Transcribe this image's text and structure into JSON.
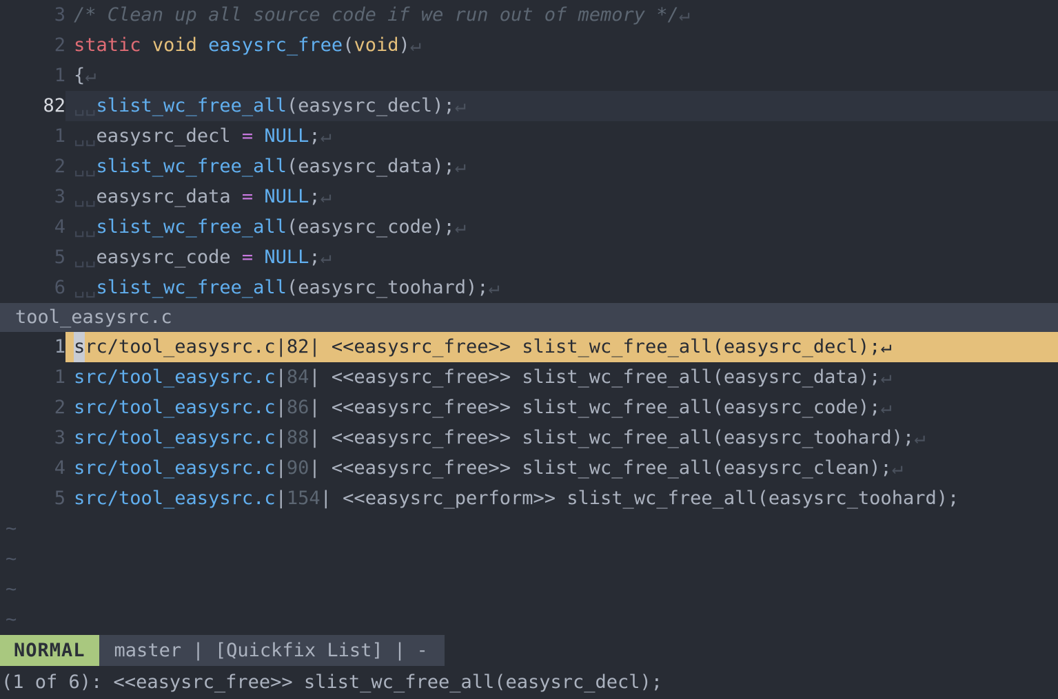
{
  "editor": {
    "window_name": "source-code-window",
    "lines": [
      {
        "num": "3",
        "current": false,
        "segments": [
          {
            "cls": "cmt",
            "text": "/* Clean up all source code if we run out of memory */"
          },
          {
            "cls": "eol",
            "text": "↵"
          }
        ]
      },
      {
        "num": "2",
        "current": false,
        "segments": [
          {
            "cls": "kw",
            "text": "static"
          },
          {
            "cls": "id",
            "text": " "
          },
          {
            "cls": "type",
            "text": "void"
          },
          {
            "cls": "id",
            "text": " "
          },
          {
            "cls": "fn",
            "text": "easysrc_free"
          },
          {
            "cls": "punc",
            "text": "("
          },
          {
            "cls": "type",
            "text": "void"
          },
          {
            "cls": "punc",
            "text": ")"
          },
          {
            "cls": "eol",
            "text": "↵"
          }
        ]
      },
      {
        "num": "1",
        "current": false,
        "segments": [
          {
            "cls": "punc",
            "text": "{"
          },
          {
            "cls": "eol",
            "text": "↵"
          }
        ]
      },
      {
        "num": "82",
        "current": true,
        "segments": [
          {
            "cls": "spc",
            "text": "␣␣"
          },
          {
            "cls": "fn",
            "text": "slist_wc_free_all"
          },
          {
            "cls": "punc",
            "text": "("
          },
          {
            "cls": "id",
            "text": "easysrc_decl"
          },
          {
            "cls": "punc",
            "text": ");"
          },
          {
            "cls": "eol",
            "text": "↵"
          }
        ]
      },
      {
        "num": "1",
        "current": false,
        "segments": [
          {
            "cls": "spc",
            "text": "␣␣"
          },
          {
            "cls": "id",
            "text": "easysrc_decl "
          },
          {
            "cls": "op",
            "text": "="
          },
          {
            "cls": "id",
            "text": " "
          },
          {
            "cls": "const",
            "text": "NULL"
          },
          {
            "cls": "punc",
            "text": ";"
          },
          {
            "cls": "eol",
            "text": "↵"
          }
        ]
      },
      {
        "num": "2",
        "current": false,
        "segments": [
          {
            "cls": "spc",
            "text": "␣␣"
          },
          {
            "cls": "fn",
            "text": "slist_wc_free_all"
          },
          {
            "cls": "punc",
            "text": "("
          },
          {
            "cls": "id",
            "text": "easysrc_data"
          },
          {
            "cls": "punc",
            "text": ");"
          },
          {
            "cls": "eol",
            "text": "↵"
          }
        ]
      },
      {
        "num": "3",
        "current": false,
        "segments": [
          {
            "cls": "spc",
            "text": "␣␣"
          },
          {
            "cls": "id",
            "text": "easysrc_data "
          },
          {
            "cls": "op",
            "text": "="
          },
          {
            "cls": "id",
            "text": " "
          },
          {
            "cls": "const",
            "text": "NULL"
          },
          {
            "cls": "punc",
            "text": ";"
          },
          {
            "cls": "eol",
            "text": "↵"
          }
        ]
      },
      {
        "num": "4",
        "current": false,
        "segments": [
          {
            "cls": "spc",
            "text": "␣␣"
          },
          {
            "cls": "fn",
            "text": "slist_wc_free_all"
          },
          {
            "cls": "punc",
            "text": "("
          },
          {
            "cls": "id",
            "text": "easysrc_code"
          },
          {
            "cls": "punc",
            "text": ");"
          },
          {
            "cls": "eol",
            "text": "↵"
          }
        ]
      },
      {
        "num": "5",
        "current": false,
        "segments": [
          {
            "cls": "spc",
            "text": "␣␣"
          },
          {
            "cls": "id",
            "text": "easysrc_code "
          },
          {
            "cls": "op",
            "text": "="
          },
          {
            "cls": "id",
            "text": " "
          },
          {
            "cls": "const",
            "text": "NULL"
          },
          {
            "cls": "punc",
            "text": ";"
          },
          {
            "cls": "eol",
            "text": "↵"
          }
        ]
      },
      {
        "num": "6",
        "current": false,
        "segments": [
          {
            "cls": "spc",
            "text": "␣␣"
          },
          {
            "cls": "fn",
            "text": "slist_wc_free_all"
          },
          {
            "cls": "punc",
            "text": "("
          },
          {
            "cls": "id",
            "text": "easysrc_toohard"
          },
          {
            "cls": "punc",
            "text": ");"
          },
          {
            "cls": "eol",
            "text": "↵"
          }
        ]
      }
    ]
  },
  "quickfix": {
    "statusline_label": "tool_easysrc.c",
    "entries": [
      {
        "num": "1",
        "current": true,
        "cursor_char": "s",
        "file": "rc/tool_easysrc.c",
        "lnum": "82",
        "text": " <<easysrc_free>> slist_wc_free_all(easysrc_decl);",
        "eol": "↵"
      },
      {
        "num": "1",
        "current": false,
        "cursor_char": "",
        "file": "src/tool_easysrc.c",
        "lnum": "84",
        "text": " <<easysrc_free>> slist_wc_free_all(easysrc_data);",
        "eol": "↵"
      },
      {
        "num": "2",
        "current": false,
        "cursor_char": "",
        "file": "src/tool_easysrc.c",
        "lnum": "86",
        "text": " <<easysrc_free>> slist_wc_free_all(easysrc_code);",
        "eol": "↵"
      },
      {
        "num": "3",
        "current": false,
        "cursor_char": "",
        "file": "src/tool_easysrc.c",
        "lnum": "88",
        "text": " <<easysrc_free>> slist_wc_free_all(easysrc_toohard);",
        "eol": "↵"
      },
      {
        "num": "4",
        "current": false,
        "cursor_char": "",
        "file": "src/tool_easysrc.c",
        "lnum": "90",
        "text": " <<easysrc_free>> slist_wc_free_all(easysrc_clean);",
        "eol": "↵"
      },
      {
        "num": "5",
        "current": false,
        "cursor_char": "",
        "file": "src/tool_easysrc.c",
        "lnum": "154",
        "text": " <<easysrc_perform>> slist_wc_free_all(easysrc_toohard);",
        "eol": ""
      }
    ],
    "filler_rows": [
      "~",
      "~",
      "~",
      "~"
    ]
  },
  "statusline": {
    "mode": "NORMAL",
    "info": "master | [Quickfix List] | -"
  },
  "cmdline": {
    "message": "(1 of 6): <<easysrc_free>> slist_wc_free_all(easysrc_decl);"
  },
  "colors": {
    "background": "#282c34",
    "cursorline": "#2f343f",
    "statusline_bg": "#3e4451",
    "mode_badge": "#a9c87f",
    "qf_cursor_highlight": "#e5c07b",
    "cursor_block": "#c8ccd4",
    "accent_blue": "#61afef",
    "keyword_red": "#e06c75",
    "type_yellow": "#e5c07b",
    "operator_magenta": "#c678dd",
    "foreground": "#abb2bf"
  }
}
